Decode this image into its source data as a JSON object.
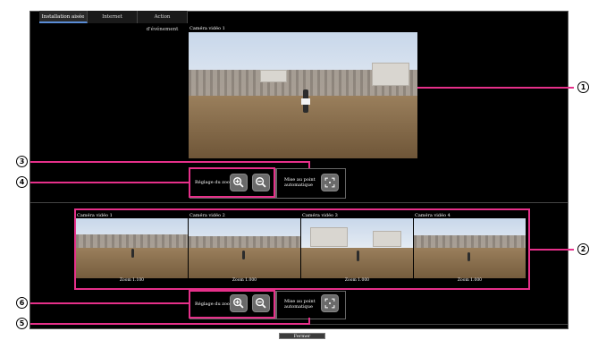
{
  "tabs": [
    {
      "label": "Installation aisée",
      "active": true
    },
    {
      "label": "Internet",
      "active": false
    },
    {
      "label": "Action d'événement",
      "active": false
    }
  ],
  "main_camera": {
    "label": "Caméra vidéo 1"
  },
  "top_controls": {
    "zoom_label": "Réglage du zoom",
    "focus_label_line1": "Mise au point",
    "focus_label_line2": "automatique"
  },
  "thumbnails": [
    {
      "label": "Caméra vidéo 1",
      "zoom": "Zoom 1.100"
    },
    {
      "label": "Caméra vidéo 2",
      "zoom": "Zoom 1.000"
    },
    {
      "label": "Caméra vidéo 3",
      "zoom": "Zoom 1.000"
    },
    {
      "label": "Caméra vidéo 4",
      "zoom": "Zoom 1.000"
    }
  ],
  "bottom_controls": {
    "zoom_label": "Réglage du zoom",
    "focus_label_line1": "Mise au point",
    "focus_label_line2": "automatique"
  },
  "close_label": "Fermer",
  "callouts": [
    "1",
    "2",
    "3",
    "4",
    "5",
    "6"
  ],
  "colors": {
    "accent": "#e6308a",
    "tab_underline": "#5a8cd6"
  }
}
